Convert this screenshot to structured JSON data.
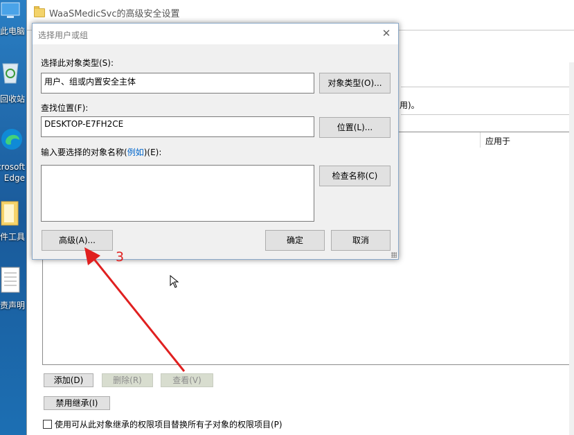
{
  "desktop": {
    "icons": [
      {
        "label": "此电脑",
        "icon": "computer-icon"
      },
      {
        "label": "回收站",
        "icon": "recycle-bin-icon"
      },
      {
        "label": "Microsoft",
        "label2": "Edge",
        "icon": "edge-icon"
      },
      {
        "label": "软件工具",
        "icon": "folder-icon"
      },
      {
        "label": "免责声明",
        "icon": "document-icon"
      }
    ]
  },
  "window": {
    "title": "WaaSMedicSvc的高级安全设置",
    "frag_note": "用)。",
    "column_apply": "应用于",
    "buttons": {
      "add": "添加(D)",
      "remove": "删除(R)",
      "view": "查看(V)",
      "disable_inherit": "禁用继承(I)"
    },
    "replace_checkbox": "使用可从此对象继承的权限项目替换所有子对象的权限项目(P)",
    "replace_checked": false
  },
  "dialog": {
    "title": "选择用户或组",
    "object_type_label": "选择此对象类型(S):",
    "object_type_value": "用户、组或内置安全主体",
    "object_type_button": "对象类型(O)...",
    "location_label": "查找位置(F):",
    "location_value": "DESKTOP-E7FH2CE",
    "location_button": "位置(L)...",
    "names_label_a": "输入要选择的对象名称(",
    "names_label_link": "例如",
    "names_label_b": ")(E):",
    "names_value": "",
    "check_names_button": "检查名称(C)",
    "advanced_button": "高级(A)...",
    "ok_button": "确定",
    "cancel_button": "取消"
  },
  "annotation": {
    "label": "3",
    "color": "#e02020"
  }
}
